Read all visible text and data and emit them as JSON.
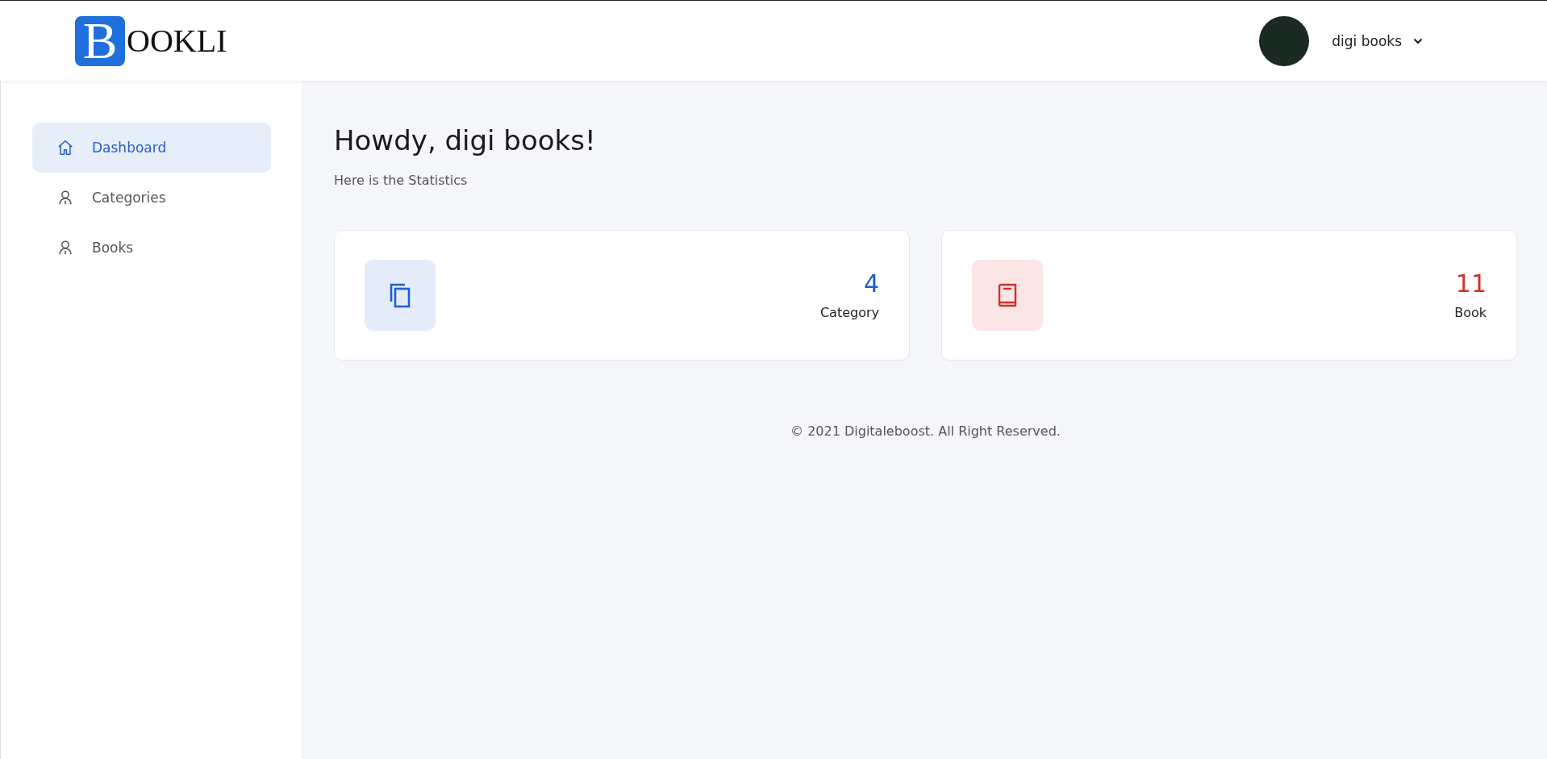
{
  "header": {
    "logo": {
      "initial": "B",
      "rest": "OOKLI"
    },
    "user": {
      "name": "digi books"
    }
  },
  "sidebar": {
    "items": [
      {
        "label": "Dashboard",
        "kind": "home",
        "selected": true
      },
      {
        "label": "Categories",
        "kind": "person",
        "selected": false
      },
      {
        "label": "Books",
        "kind": "person",
        "selected": false
      }
    ]
  },
  "main": {
    "title": "Howdy, digi books!",
    "subtitle": "Here is the Statistics",
    "cards": [
      {
        "kind": "copies",
        "value": "4",
        "label": "Category",
        "color": "#1f5fcc"
      },
      {
        "kind": "book",
        "value": "11",
        "label": "Book",
        "color": "#d0312d"
      }
    ]
  },
  "footer": "© 2021 Digitaleboost. All Right Reserved."
}
